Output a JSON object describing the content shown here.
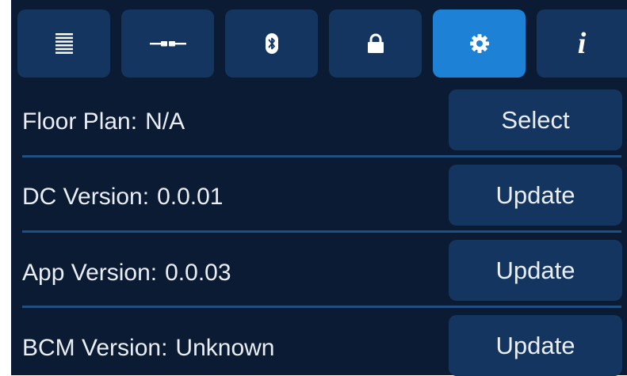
{
  "tabs": [
    {
      "icon": "list-lines-icon",
      "active": false
    },
    {
      "icon": "connection-link-icon",
      "active": false
    },
    {
      "icon": "bluetooth-icon",
      "active": false
    },
    {
      "icon": "lock-icon",
      "active": false
    },
    {
      "icon": "gear-icon",
      "active": true
    },
    {
      "icon": "info-icon",
      "active": false,
      "glyph": "i"
    }
  ],
  "rows": [
    {
      "label": "Floor Plan:",
      "value": "N/A",
      "button": "Select"
    },
    {
      "label": "DC Version:",
      "value": "0.0.01",
      "button": "Update"
    },
    {
      "label": "App Version:",
      "value": "0.0.03",
      "button": "Update"
    },
    {
      "label": "BCM Version:",
      "value": "Unknown",
      "button": "Update"
    }
  ],
  "colors": {
    "background": "#0b1b33",
    "button": "#14355f",
    "active_tab": "#1d82d6",
    "divider": "#1f4f83",
    "text": "#e9eef5"
  }
}
